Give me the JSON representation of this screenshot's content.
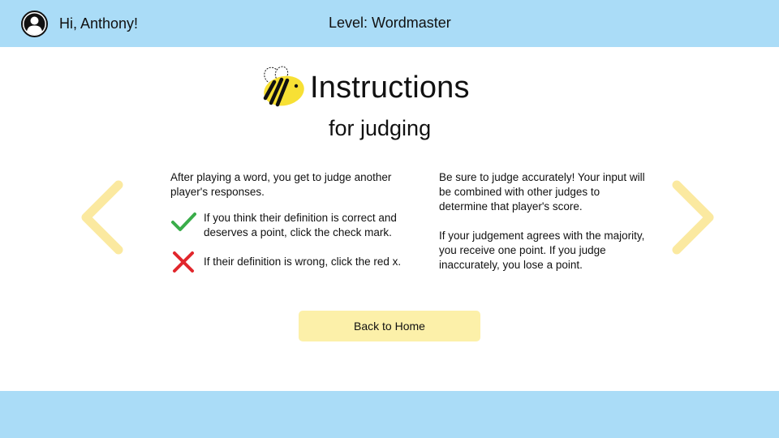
{
  "header": {
    "greeting": "Hi, Anthony!",
    "level": "Level: Wordmaster",
    "avatar_icon": "user-avatar-icon"
  },
  "main": {
    "title": "Instructions",
    "subtitle": "for judging",
    "logo_icon": "bee-icon",
    "left_column": {
      "intro": "After playing a word, you get to judge another player's responses.",
      "rules": [
        {
          "icon": "check-icon",
          "color": "#3aad4a",
          "text": "If you think their definition is correct and deserves a point, click the check mark."
        },
        {
          "icon": "x-icon",
          "color": "#e1262c",
          "text": "If their definition is wrong, click the red x."
        }
      ]
    },
    "right_column": {
      "paragraph_1": "Be sure to judge accurately! Your input will be combined with other judges to determine that player's score.",
      "paragraph_2": "If your judgement agrees with the majority, you receive one point. If you judge inaccurately, you lose a point."
    },
    "back_button": "Back to Home"
  },
  "navigation": {
    "prev_icon": "chevron-left-icon",
    "next_icon": "chevron-right-icon"
  },
  "colors": {
    "bar": "#aadcf7",
    "accent_yellow": "#fcf0a9",
    "arrow_yellow": "#fbe9a0",
    "bee_yellow": "#f7e034"
  }
}
